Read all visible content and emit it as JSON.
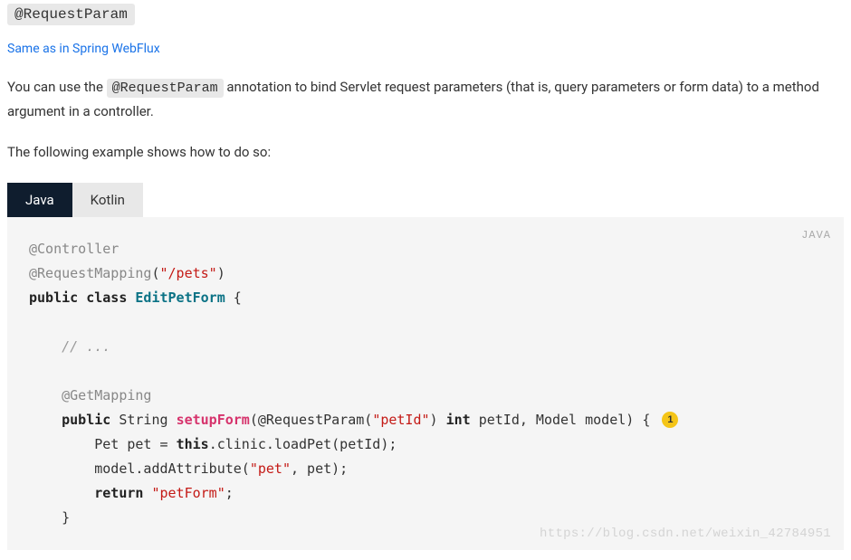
{
  "heading": "@RequestParam",
  "link": "Same as in Spring WebFlux",
  "paragraph1_pre": "You can use the ",
  "paragraph1_code": "@RequestParam",
  "paragraph1_post": " annotation to bind Servlet request parameters (that is, query parameters or form data) to a method argument in a controller.",
  "paragraph2": "The following example shows how to do so:",
  "tabs": {
    "java": "Java",
    "kotlin": "Kotlin"
  },
  "code_lang_label": "JAVA",
  "code": {
    "ann_controller": "@Controller",
    "ann_requestmapping": "@RequestMapping",
    "str_pets": "\"/pets\"",
    "paren_open": "(",
    "paren_close": ")",
    "kw_public": "public",
    "kw_class": "class",
    "cls_name": "EditPetForm",
    "brace_open": " {",
    "comment_ellipsis": "// ...",
    "ann_getmapping": "@GetMapping",
    "ret_type": " String ",
    "method_name": "setupForm",
    "param_prefix": "(@RequestParam(",
    "str_petid": "\"petId\"",
    "param_mid": ") ",
    "kw_int": "int",
    "param_tail": " petId, Model model) { ",
    "callout1": "1",
    "line_pet": "        Pet pet = ",
    "kw_this": "this",
    "line_pet_tail": ".clinic.loadPet(petId);",
    "line_model_pre": "        model.addAttribute(",
    "str_pet": "\"pet\"",
    "line_model_post": ", pet);",
    "line_return_pre": "        ",
    "kw_return": "return",
    "space": " ",
    "str_petform": "\"petForm\"",
    "semicolon": ";",
    "line_close_brace": "    }"
  },
  "watermark": "https://blog.csdn.net/weixin_42784951"
}
